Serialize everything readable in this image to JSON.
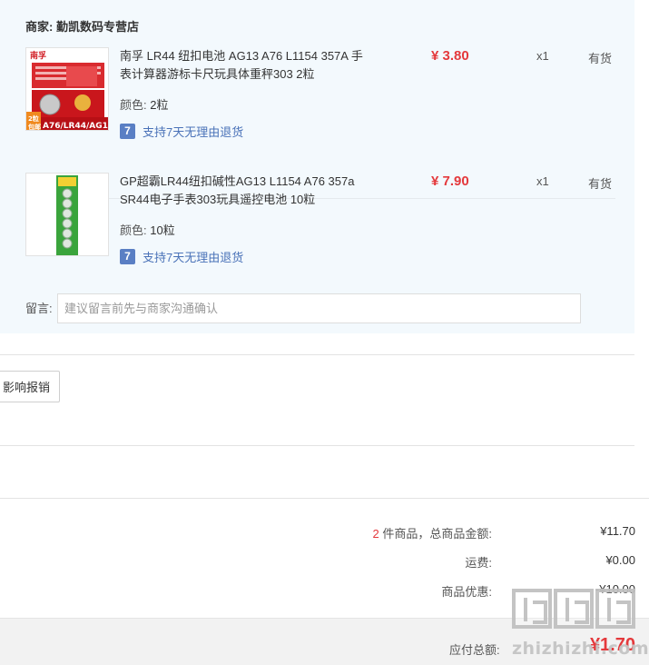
{
  "shop": {
    "label": "商家:",
    "name": "勤凯数码专营店"
  },
  "items": [
    {
      "title": "南孚 LR44 纽扣电池 AG13 A76 L1154 357A 手表计算器游标卡尺玩具体重秤303 2粒",
      "color_label": "颜色:",
      "color_value": "2粒",
      "returns_badge": "7",
      "returns": "支持7天无理由退货",
      "price": "¥ 3.80",
      "qty": "x1",
      "stock": "有货",
      "image_text": {
        "brand": "南孚",
        "models": "A76/LR44/AG13",
        "bubble": "2粒\n包邮"
      }
    },
    {
      "title": "GP超霸LR44纽扣碱性AG13 L1154 A76 357a SR44电子手表303玩具遥控电池 10粒",
      "color_label": "颜色:",
      "color_value": "10粒",
      "returns_badge": "7",
      "returns": "支持7天无理由退货",
      "price": "¥ 7.90",
      "qty": "x1",
      "stock": "有货"
    }
  ],
  "memo": {
    "label": "留言:",
    "placeholder": "建议留言前先与商家沟通确认"
  },
  "invoice_button": "影响报销",
  "summary": {
    "count": "2",
    "count_suffix": "件商品，总商品金额:",
    "goods_total": "¥11.70",
    "shipping_label": "运费:",
    "shipping": "¥0.00",
    "discount_label": "商品优惠:",
    "discount": "-¥10.00"
  },
  "total": {
    "label": "应付总额:",
    "value": "¥1.70"
  },
  "watermark": {
    "text": "zhizhizhi.com"
  },
  "colors": {
    "price_red": "#e4393c",
    "panel_bg": "#f3f9fd",
    "link_blue": "#4a72b8"
  }
}
